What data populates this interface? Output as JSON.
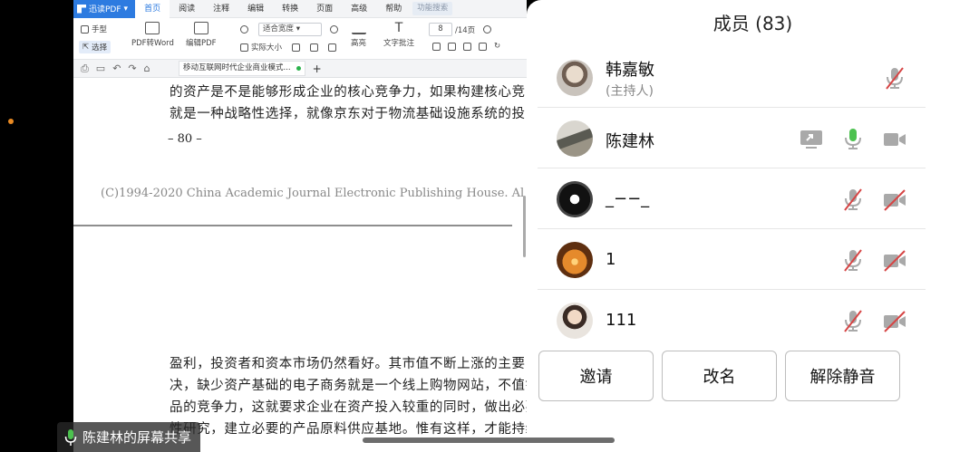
{
  "pdf_app": {
    "brand": "迅读PDF",
    "tabs": [
      "首页",
      "阅读",
      "注释",
      "编辑",
      "转换",
      "页面",
      "高级",
      "帮助"
    ],
    "search_placeholder": "功能搜索",
    "tools": {
      "hand": "手型",
      "select": "选择",
      "pdf_to_word": "PDF转Word",
      "edit_pdf": "编辑PDF",
      "zoom_mode": "适合宽度",
      "actual_size": "实际大小",
      "highlight": "高亮",
      "text_note": "文字批注",
      "page_current": "8",
      "page_total": "/14页"
    },
    "doc_tab_title": "移动互联网时代企业商业模式...",
    "new_tab": "+",
    "page": {
      "line1": "的资产是不是能够形成企业的核心竞争力，如果构建核心竞",
      "line2": "就是一种战略性选择，就像京东对于物流基础设施系统的投",
      "page_number": "– 80 –",
      "copyright": "(C)1994-2020 China Academic Journal Electronic Publishing House. Al",
      "line3": "盈利，投资者和资本市场仍然看好。其市值不断上涨的主要",
      "line4": "决，缺少资产基础的电子商务就是一个线上购物网站，不值钱",
      "line5": "品的竞争力，这就要求企业在资产投入较重的同时，做出必要",
      "line6": "性研究，建立必要的产品原料供应基地。惟有这样，才能持续"
    }
  },
  "members_panel": {
    "title": "成员 (83)",
    "members": [
      {
        "name": "韩嘉敏",
        "role": "(主持人)",
        "mic": "mic-off",
        "video": "none",
        "sharing": false
      },
      {
        "name": "陈建林",
        "role": "",
        "mic": "mic-on",
        "video": "video-on",
        "sharing": true
      },
      {
        "name": "_−−_",
        "role": "",
        "mic": "mic-off",
        "video": "video-off",
        "sharing": false
      },
      {
        "name": "1",
        "role": "",
        "mic": "mic-off",
        "video": "video-off",
        "sharing": false
      },
      {
        "name": "111",
        "role": "",
        "mic": "mic-off",
        "video": "video-off",
        "sharing": false
      }
    ],
    "buttons": {
      "invite": "邀请",
      "rename": "改名",
      "unmute": "解除静音"
    }
  },
  "screen_share_label": "陈建林的屏幕共享",
  "colors": {
    "mic_on": "#4cc14f",
    "icon_gray": "#a9a9a9",
    "off_slash": "#d64545",
    "accent": "#2d7be0"
  }
}
